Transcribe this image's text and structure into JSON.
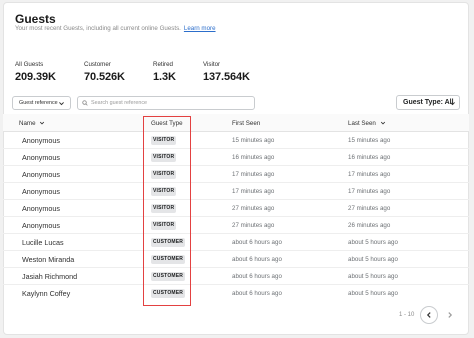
{
  "page": {
    "title": "Guests",
    "subtitle": "Your most recent Guests, including all current online Guests.",
    "learn_more": "Learn more"
  },
  "stats": [
    {
      "label": "All Guests",
      "value": "209.39K"
    },
    {
      "label": "Customer",
      "value": "70.526K"
    },
    {
      "label": "Retired",
      "value": "1.3K"
    },
    {
      "label": "Visitor",
      "value": "137.564K"
    }
  ],
  "filters": {
    "guest_reference_label": "Guest reference",
    "search_placeholder": "Search guest reference",
    "guest_type_label": "Guest Type: All"
  },
  "table": {
    "columns": {
      "name": "Name",
      "type": "Guest Type",
      "first_seen": "First Seen",
      "last_seen": "Last Seen"
    },
    "rows": [
      {
        "name": "Anonymous",
        "type": "VISITOR",
        "first_seen": "15 minutes ago",
        "last_seen": "15 minutes ago"
      },
      {
        "name": "Anonymous",
        "type": "VISITOR",
        "first_seen": "16 minutes ago",
        "last_seen": "16 minutes ago"
      },
      {
        "name": "Anonymous",
        "type": "VISITOR",
        "first_seen": "17 minutes ago",
        "last_seen": "17 minutes ago"
      },
      {
        "name": "Anonymous",
        "type": "VISITOR",
        "first_seen": "17 minutes ago",
        "last_seen": "17 minutes ago"
      },
      {
        "name": "Anonymous",
        "type": "VISITOR",
        "first_seen": "27 minutes ago",
        "last_seen": "27 minutes ago"
      },
      {
        "name": "Anonymous",
        "type": "VISITOR",
        "first_seen": "27 minutes ago",
        "last_seen": "26 minutes ago"
      },
      {
        "name": "Lucille Lucas",
        "type": "CUSTOMER",
        "first_seen": "about 6 hours ago",
        "last_seen": "about 5 hours ago"
      },
      {
        "name": "Weston Miranda",
        "type": "CUSTOMER",
        "first_seen": "about 6 hours ago",
        "last_seen": "about 5 hours ago"
      },
      {
        "name": "Jasiah Richmond",
        "type": "CUSTOMER",
        "first_seen": "about 6 hours ago",
        "last_seen": "about 5 hours ago"
      },
      {
        "name": "Kaylynn Coffey",
        "type": "CUSTOMER",
        "first_seen": "about 6 hours ago",
        "last_seen": "about 5 hours ago"
      }
    ]
  },
  "pagination": {
    "range": "1 - 10"
  },
  "icons": {
    "search": "search-icon",
    "chevron": "chevron-down-icon",
    "prev": "chevron-left-icon",
    "next": "chevron-right-icon"
  },
  "colors": {
    "highlight": "#e34141",
    "link": "#2c6ecb",
    "badge_bg": "#e4e5e7"
  }
}
